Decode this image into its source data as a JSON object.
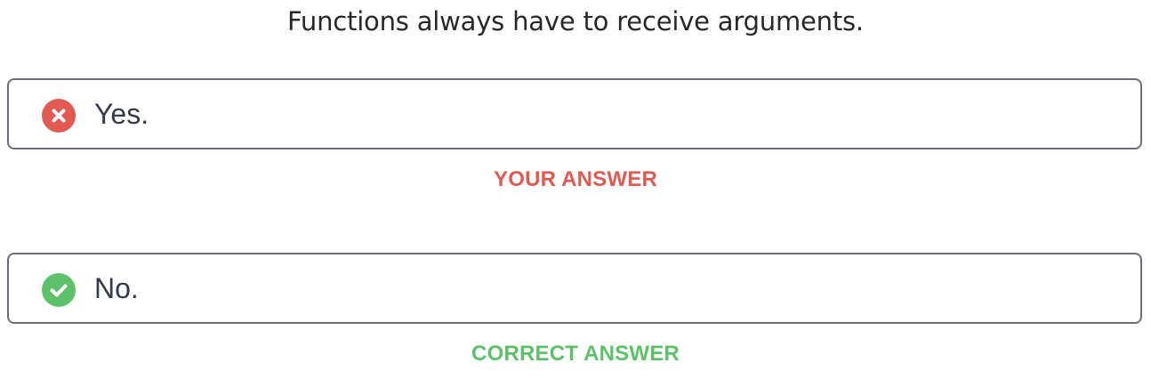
{
  "question": {
    "text": "Functions always have to receive arguments."
  },
  "options": [
    {
      "label": "Yes.",
      "status_icon": "x-circle-icon",
      "status_color": "#e05a52",
      "verdict": "YOUR ANSWER",
      "verdict_color": "#e05a52"
    },
    {
      "label": "No.",
      "status_icon": "check-circle-icon",
      "status_color": "#5dc16a",
      "verdict": "CORRECT ANSWER",
      "verdict_color": "#5dc16a"
    }
  ]
}
